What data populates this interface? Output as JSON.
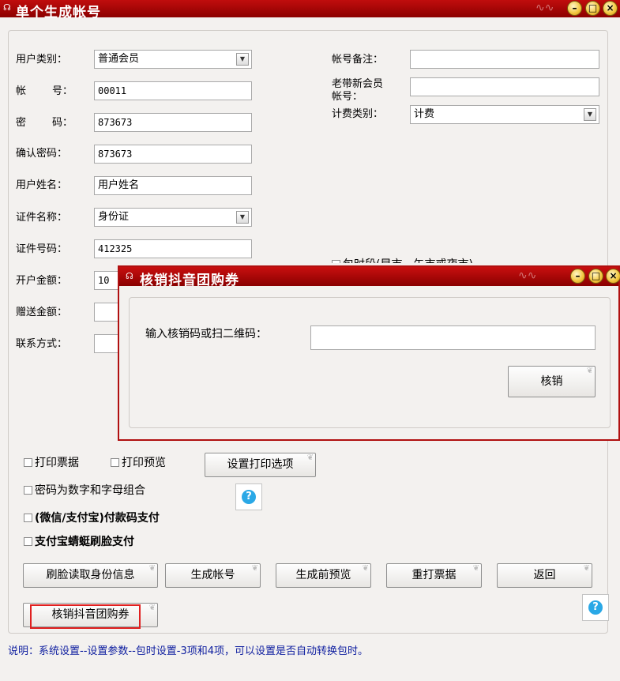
{
  "window": {
    "title": "单个生成帐号",
    "controls": [
      "minimize",
      "maximize",
      "close"
    ]
  },
  "form_left": {
    "user_type": {
      "label": "用户类别：",
      "value": "普通会员"
    },
    "account": {
      "label": "帐      号：",
      "value": "00011"
    },
    "password": {
      "label": "密      码：",
      "value": "873673"
    },
    "confirm_password": {
      "label": "确认密码：",
      "value": "873673"
    },
    "user_name": {
      "label": "用户姓名：",
      "value": "用户姓名"
    },
    "id_type": {
      "label": "证件名称：",
      "value": "身份证"
    },
    "id_number": {
      "label": "证件号码：",
      "value": "412325"
    },
    "open_amount": {
      "label": "开户金额：",
      "value": "10"
    },
    "gift_amount": {
      "label": "赠送金额：",
      "value": ""
    },
    "contact": {
      "label": "联系方式：",
      "value": ""
    }
  },
  "form_right": {
    "account_note": {
      "label": "帐号备注：",
      "value": ""
    },
    "old_new_member": {
      "label_line1": "老带新会员",
      "label_line2": "帐号：",
      "value": ""
    },
    "billing_type": {
      "label": "计费类别：",
      "value": "计费"
    },
    "period_partial": "包时段(早市，午市或夜市)"
  },
  "options": {
    "print_ticket": "打印票据",
    "print_preview": "打印预览",
    "print_settings_button": "设置打印选项",
    "password_combo": "密码为数字和字母组合",
    "wechat_alipay": "(微信/支付宝)付款码支付",
    "alipay_face": "支付宝蜻蜓刷脸支付"
  },
  "buttons": {
    "face_id": "刷脸读取身份信息",
    "generate": "生成帐号",
    "preview": "生成前预览",
    "reprint": "重打票据",
    "back": "返回",
    "douyin": "核销抖音团购券"
  },
  "note": "说明：系统设置--设置参数--包时设置-3项和4项，可以设置是否自动转换包时。",
  "dialog": {
    "title": "核销抖音团购券",
    "input_label": "输入核销码或扫二维码：",
    "input_value": "",
    "confirm_button": "核销"
  },
  "colors": {
    "title_bar": "#b00a0a",
    "highlight_border": "#e02020",
    "help_icon": "#2aa8e6",
    "note_text": "#1020a0"
  }
}
